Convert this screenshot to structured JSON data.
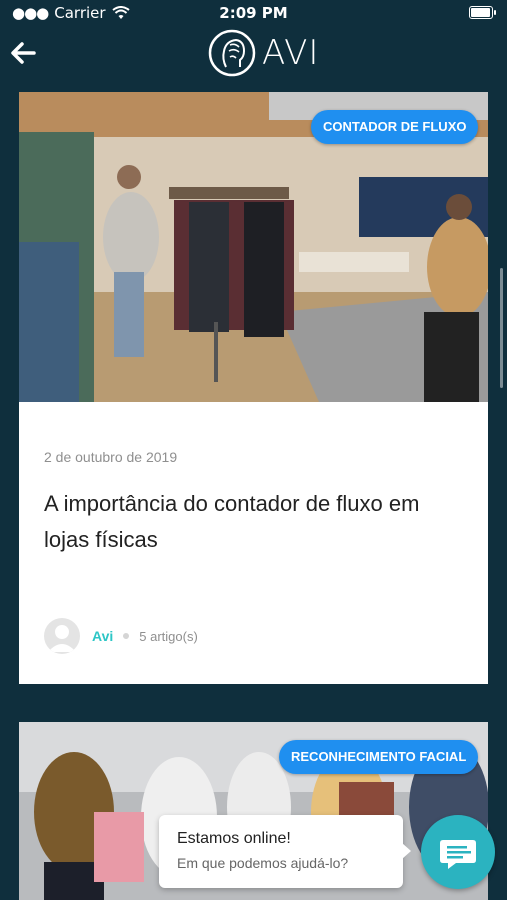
{
  "status_bar": {
    "carrier": "Carrier",
    "time": "2:09 PM"
  },
  "header": {
    "logo_text": "AVI",
    "back_icon": "arrow-left-icon",
    "logo_icon": "face-scan-icon"
  },
  "colors": {
    "background": "#0f2f3d",
    "badge": "#1f8ff0",
    "author": "#2cc6c6",
    "chat": "#2bb3c0"
  },
  "articles": [
    {
      "badge": "CONTADOR DE FLUXO",
      "date": "2 de outubro de 2019",
      "title": "A importância do contador de fluxo em lojas físicas",
      "author": "Avi",
      "article_count": "5 artigo(s)"
    },
    {
      "badge": "RECONHECIMENTO FACIAL"
    }
  ],
  "chat": {
    "title": "Estamos online!",
    "subtitle": "Em que podemos ajudá-lo?",
    "icon": "chat-icon"
  }
}
